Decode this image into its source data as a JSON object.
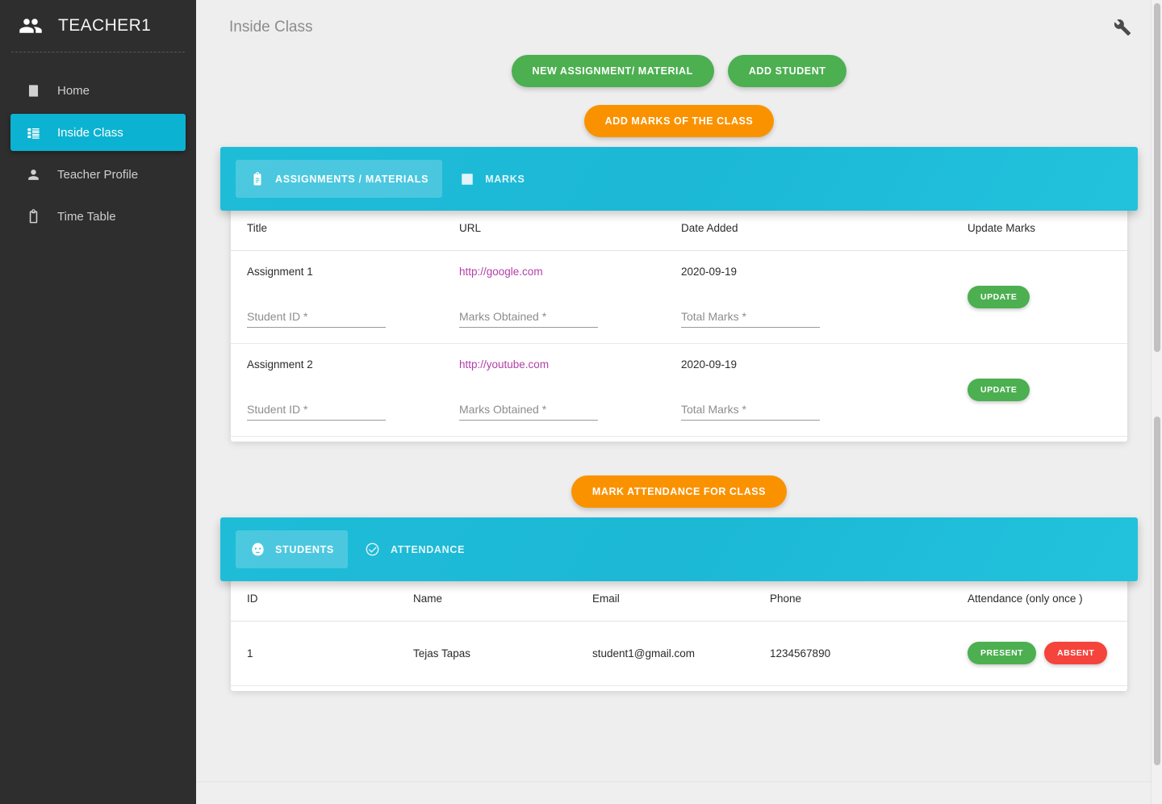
{
  "sidebar": {
    "logo_icon": "people-icon",
    "title": "TEACHER1",
    "items": [
      {
        "label": "Home",
        "icon": "book-icon",
        "active": false
      },
      {
        "label": "Inside Class",
        "icon": "list-icon",
        "active": true
      },
      {
        "label": "Teacher Profile",
        "icon": "person-icon",
        "active": false
      },
      {
        "label": "Time Table",
        "icon": "clipboard-icon",
        "active": false
      }
    ]
  },
  "topbar": {
    "page_title": "Inside Class",
    "settings_icon": "wrench-icon"
  },
  "actions": {
    "new_assignment": "NEW ASSIGNMENT/ MATERIAL",
    "add_student": "ADD STUDENT",
    "add_marks": "ADD MARKS OF THE CLASS",
    "mark_attendance": "MARK ATTENDANCE FOR CLASS"
  },
  "assignments_card": {
    "tabs": [
      {
        "label": "ASSIGNMENTS / MATERIALS",
        "icon": "clipboard-icon",
        "active": true
      },
      {
        "label": "MARKS",
        "icon": "bar-chart-icon",
        "active": false
      }
    ],
    "columns": [
      "Title",
      "URL",
      "Date Added",
      "Update Marks"
    ],
    "rows": [
      {
        "title": "Assignment 1",
        "url": "http://google.com",
        "date_added": "2020-09-19",
        "student_id_placeholder": "Student ID *",
        "marks_obtained_placeholder": "Marks Obtained *",
        "total_marks_placeholder": "Total Marks *",
        "student_id_value": "",
        "marks_obtained_value": "",
        "total_marks_value": "",
        "update_label": "UPDATE"
      },
      {
        "title": "Assignment 2",
        "url": "http://youtube.com",
        "date_added": "2020-09-19",
        "student_id_placeholder": "Student ID *",
        "marks_obtained_placeholder": "Marks Obtained *",
        "total_marks_placeholder": "Total Marks *",
        "student_id_value": "",
        "marks_obtained_value": "",
        "total_marks_value": "",
        "update_label": "UPDATE"
      }
    ]
  },
  "students_card": {
    "tabs": [
      {
        "label": "STUDENTS",
        "icon": "face-icon",
        "active": true
      },
      {
        "label": "ATTENDANCE",
        "icon": "check-circle-icon",
        "active": false
      }
    ],
    "columns": [
      "ID",
      "Name",
      "Email",
      "Phone",
      "Attendance (only once )"
    ],
    "rows": [
      {
        "id": "1",
        "name": "Tejas Tapas",
        "email": "student1@gmail.com",
        "phone": "1234567890",
        "present_label": "PRESENT",
        "absent_label": "ABSENT"
      }
    ]
  },
  "colors": {
    "sidebar_bg": "#2e2e2e",
    "accent_teal": "#0cb2d1",
    "tab_teal": "#1fbcd8",
    "green": "#4caf50",
    "orange": "#fa9200",
    "red": "#f4443c",
    "link": "#b13fa8",
    "page_bg": "#eeeeee"
  }
}
